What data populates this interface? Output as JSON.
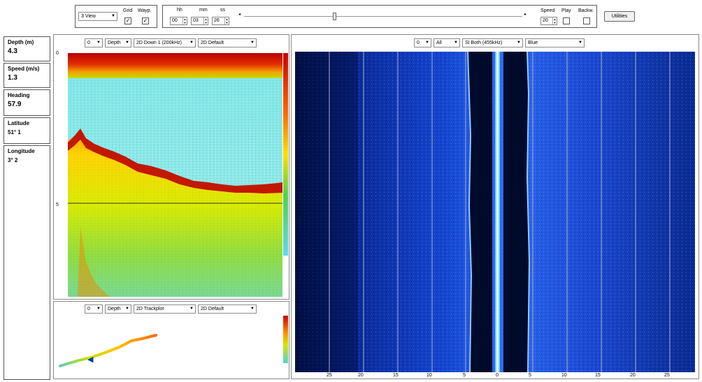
{
  "toolbar": {
    "view_select": "3 View",
    "grid_label": "Grid",
    "grid_checked": true,
    "wayp_label": "Wayp.",
    "wayp_checked": true,
    "time": {
      "hh_label": "hh",
      "mm_label": "mm",
      "ss_label": "ss",
      "hh": "00",
      "mm": "03",
      "ss": "26"
    },
    "speed_label": "Speed",
    "speed_value": "20",
    "play_label": "Play",
    "backw_label": "Backw.",
    "utilities_label": "Utilities"
  },
  "stats": [
    {
      "label": "Depth (m)",
      "value": "4.3"
    },
    {
      "label": "Speed (m/s)",
      "value": "1.3"
    },
    {
      "label": "Heading",
      "value": "57.9"
    },
    {
      "label": "Latitude",
      "value": "51° 1"
    },
    {
      "label": "Longitude",
      "value": "3° 2"
    }
  ],
  "down_panel": {
    "channel": "0",
    "mode": "Depth",
    "source": "2D Down 1 (200kHz)",
    "palette": "2D Default",
    "depth_ticks": [
      "0",
      "5"
    ]
  },
  "track_panel": {
    "channel": "0",
    "mode": "Depth",
    "source": "2D Trackplot",
    "palette": "2D Default"
  },
  "side_panel": {
    "channel": "0",
    "scope": "All",
    "source": "SI Both (455kHz)",
    "palette": "Blue",
    "range_ticks": [
      "25",
      "20",
      "15",
      "10",
      "5",
      "0",
      "5",
      "10",
      "15",
      "20",
      "25"
    ]
  },
  "colors": {
    "sonar_deep": "#001a6e",
    "sonar_bright": "#2a6cff",
    "water_column": "#000a2a"
  }
}
